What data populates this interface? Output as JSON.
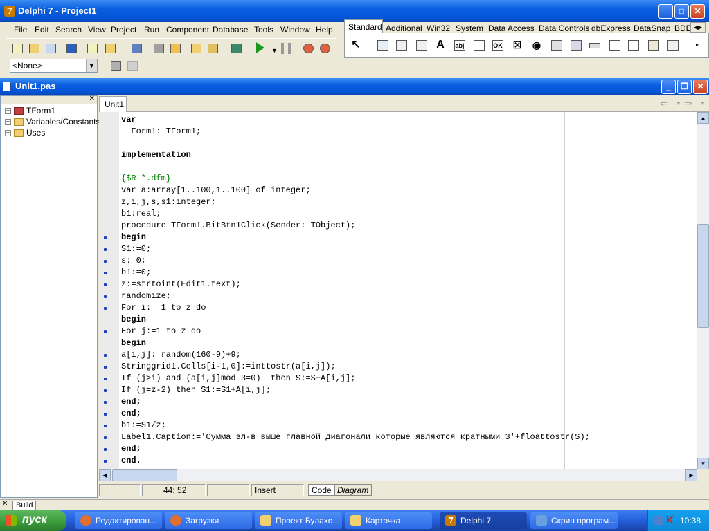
{
  "app": {
    "title": "Delphi 7 - Project1",
    "icon": "delphi-icon"
  },
  "menu": [
    "File",
    "Edit",
    "Search",
    "View",
    "Project",
    "Run",
    "Component",
    "Database",
    "Tools",
    "Window",
    "Help"
  ],
  "palette_tabs": [
    "Standard",
    "Additional",
    "Win32",
    "System",
    "Data Access",
    "Data Controls",
    "dbExpress",
    "DataSnap",
    "BDE"
  ],
  "palette_glyphs": [
    "A",
    "ab|",
    "OK",
    "☒",
    "◉"
  ],
  "object_combo": {
    "value": "<None>"
  },
  "editor": {
    "title": "Unit1.pas",
    "tab": "Unit1",
    "lines": [
      {
        "t": "var",
        "b": true
      },
      {
        "t": "  Form1: TForm1;"
      },
      {
        "t": ""
      },
      {
        "t": "implementation",
        "b": true
      },
      {
        "t": ""
      },
      {
        "t": "{$R *.dfm}",
        "c": true
      },
      {
        "t": "var a:array[1..100,1..100] of integer;"
      },
      {
        "t": "z,i,j,s,s1:integer;"
      },
      {
        "t": "b1:real;"
      },
      {
        "t": "procedure TForm1.BitBtn1Click(Sender: TObject);"
      },
      {
        "t": "begin",
        "b": true,
        "dot": true
      },
      {
        "t": "S1:=0;",
        "dot": true
      },
      {
        "t": "s:=0;",
        "dot": true
      },
      {
        "t": "b1:=0;",
        "dot": true
      },
      {
        "t": "z:=strtoint(Edit1.text);",
        "dot": true
      },
      {
        "t": "randomize;",
        "dot": true
      },
      {
        "t": "For i:= 1 to z do",
        "dot": true
      },
      {
        "t": "begin",
        "b": true
      },
      {
        "t": "For j:=1 to z do",
        "dot": true
      },
      {
        "t": "begin",
        "b": true
      },
      {
        "t": "a[i,j]:=random(160-9)+9;",
        "dot": true
      },
      {
        "t": "Stringgrid1.Cells[i-1,0]:=inttostr(a[i,j]);",
        "dot": true
      },
      {
        "t": "If (j>i) and (a[i,j]mod 3=0)  then S:=S+A[i,j];",
        "dot": true
      },
      {
        "t": "If (j=z-2) then S1:=S1+A[i,j];",
        "dot": true
      },
      {
        "t": "end;",
        "b": true,
        "dot": true
      },
      {
        "t": "end;",
        "b": true,
        "dot": true
      },
      {
        "t": "b1:=S1/z;",
        "dot": true
      },
      {
        "t": "Label1.Caption:='Сумма эл-в выше главной диагонали которые являются кратными 3'+floattostr(S);",
        "dot": true
      },
      {
        "t": "end;",
        "b": true,
        "dot": true
      },
      {
        "t": "end.",
        "b": true,
        "dot": true
      }
    ]
  },
  "explorer": {
    "items": [
      "TForm1",
      "Variables/Constants",
      "Uses"
    ]
  },
  "status": {
    "position": "44: 52",
    "mode": "Insert",
    "tab_code": "Code",
    "tab_diagram": "Diagram"
  },
  "build_tab": "Build",
  "taskbar": {
    "start": "пуск",
    "tasks": [
      "Редактирован...",
      "Загрузки",
      "Проект Булахо...",
      "Карточка",
      "Delphi 7",
      "Скрин програм..."
    ],
    "clock": "10:38"
  }
}
